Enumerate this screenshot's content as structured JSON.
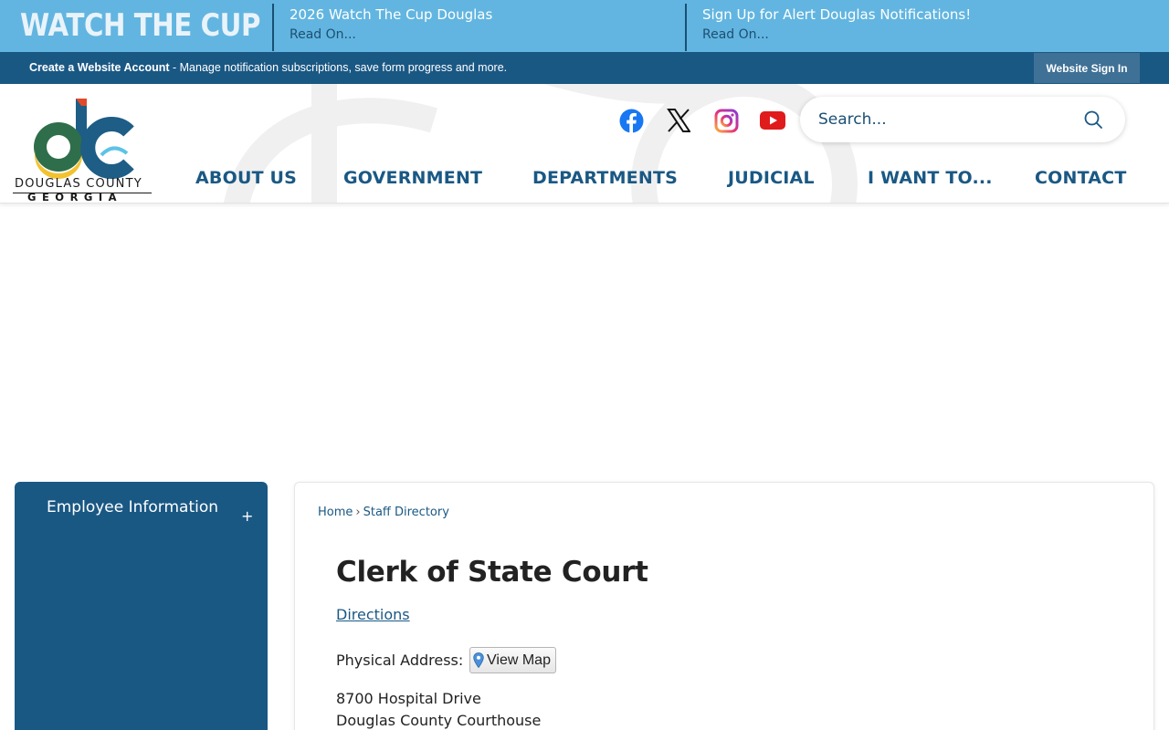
{
  "alert_bar": {
    "brand": "WATCH THE CUP",
    "items": [
      {
        "title": "2026 Watch The Cup Douglas",
        "read_more": "Read On..."
      },
      {
        "title": "Sign Up for Alert Douglas Notifications!",
        "read_more": "Read On..."
      }
    ]
  },
  "account_bar": {
    "create_label": "Create a Website Account",
    "create_desc": " - Manage notification subscriptions, save form progress and more.",
    "sign_in_label": "Website Sign In"
  },
  "header": {
    "logo": {
      "line1": "DOUGLAS COUNTY",
      "line2": "GEORGIA"
    },
    "social_icons": [
      "facebook-icon",
      "x-icon",
      "instagram-icon",
      "youtube-icon"
    ],
    "search_placeholder": "Search...",
    "nav": [
      "ABOUT US",
      "GOVERNMENT",
      "DEPARTMENTS",
      "JUDICIAL",
      "I WANT TO...",
      "CONTACT"
    ]
  },
  "sidebar": {
    "items": [
      {
        "label": "Employee Information",
        "toggle": "+"
      }
    ]
  },
  "main": {
    "breadcrumb": [
      "Home",
      "Staff Directory"
    ],
    "breadcrumb_sep": "›",
    "title": "Clerk of State Court",
    "directions_link": "Directions",
    "physical_address_label": "Physical Address:",
    "view_map_label": "View Map",
    "address_lines": [
      "8700 Hospital Drive",
      "Douglas County Courthouse"
    ]
  },
  "colors": {
    "alert_bar_bg": "#62b5e0",
    "primary_blue": "#1a5884",
    "sign_in_bg": "#3f7196"
  }
}
